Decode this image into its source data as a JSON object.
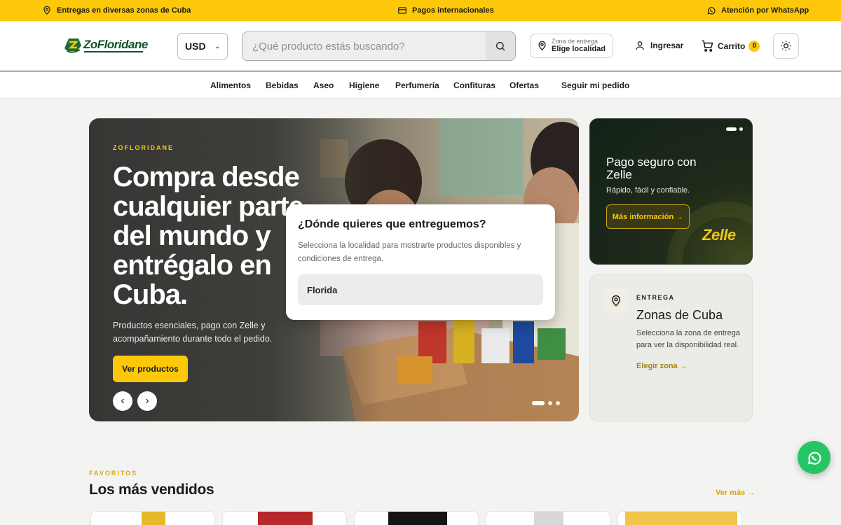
{
  "topbar": {
    "delivery": "Entregas en diversas zonas de Cuba",
    "payments": "Pagos internacionales",
    "whatsapp": "Atención por WhatsApp",
    "background": "#fdc80a"
  },
  "header": {
    "logo_text": "ZoFloridane",
    "currency": "USD",
    "search_placeholder": "¿Qué producto estás buscando?",
    "location_small": "Zona de entrega",
    "location_big": "Elige localidad",
    "login": "Ingresar",
    "cart_label": "Carrito",
    "cart_count": "0",
    "icons": [
      "map-pin-icon",
      "credit-card-icon",
      "whatsapp-icon",
      "search-icon",
      "user-icon",
      "cart-icon",
      "sun-icon"
    ]
  },
  "nav": {
    "items": [
      "Alimentos",
      "Bebidas",
      "Aseo",
      "Higiene",
      "Perfumería",
      "Confituras",
      "Ofertas",
      "Seguir mi pedido"
    ]
  },
  "hero": {
    "kicker": "ZOFLORIDANE",
    "title": "Compra desde cualquier parte del mundo y entrégalo en Cuba.",
    "description": "Productos esenciales, pago con Zelle y acompañamiento durante todo el pedido.",
    "cta": "Ver productos",
    "slides": 3,
    "active_slide": 1
  },
  "modal": {
    "title": "¿Dónde quieres que entreguemos?",
    "description": "Selecciona la localidad para mostrarte productos disponibles y condiciones de entrega.",
    "option": "Florida"
  },
  "zelle_card": {
    "title": "Pago seguro con Zelle",
    "subtitle": "Rápido, fácil y confiable.",
    "button": "Más información →",
    "brand": "Zelle",
    "accent": "#f0c419"
  },
  "zones_card": {
    "kicker": "ENTREGA",
    "title": "Zonas de Cuba",
    "description": "Selecciona la zona de entrega para ver la disponibilidad real.",
    "link": "Elegir zona →"
  },
  "bestsellers": {
    "kicker": "FAVORITOS",
    "title": "Los más vendidos",
    "more": "Ver más →"
  },
  "colors": {
    "brand_yellow": "#fdc80a",
    "logo_green": "#14532d",
    "whatsapp_green": "#25c564"
  }
}
